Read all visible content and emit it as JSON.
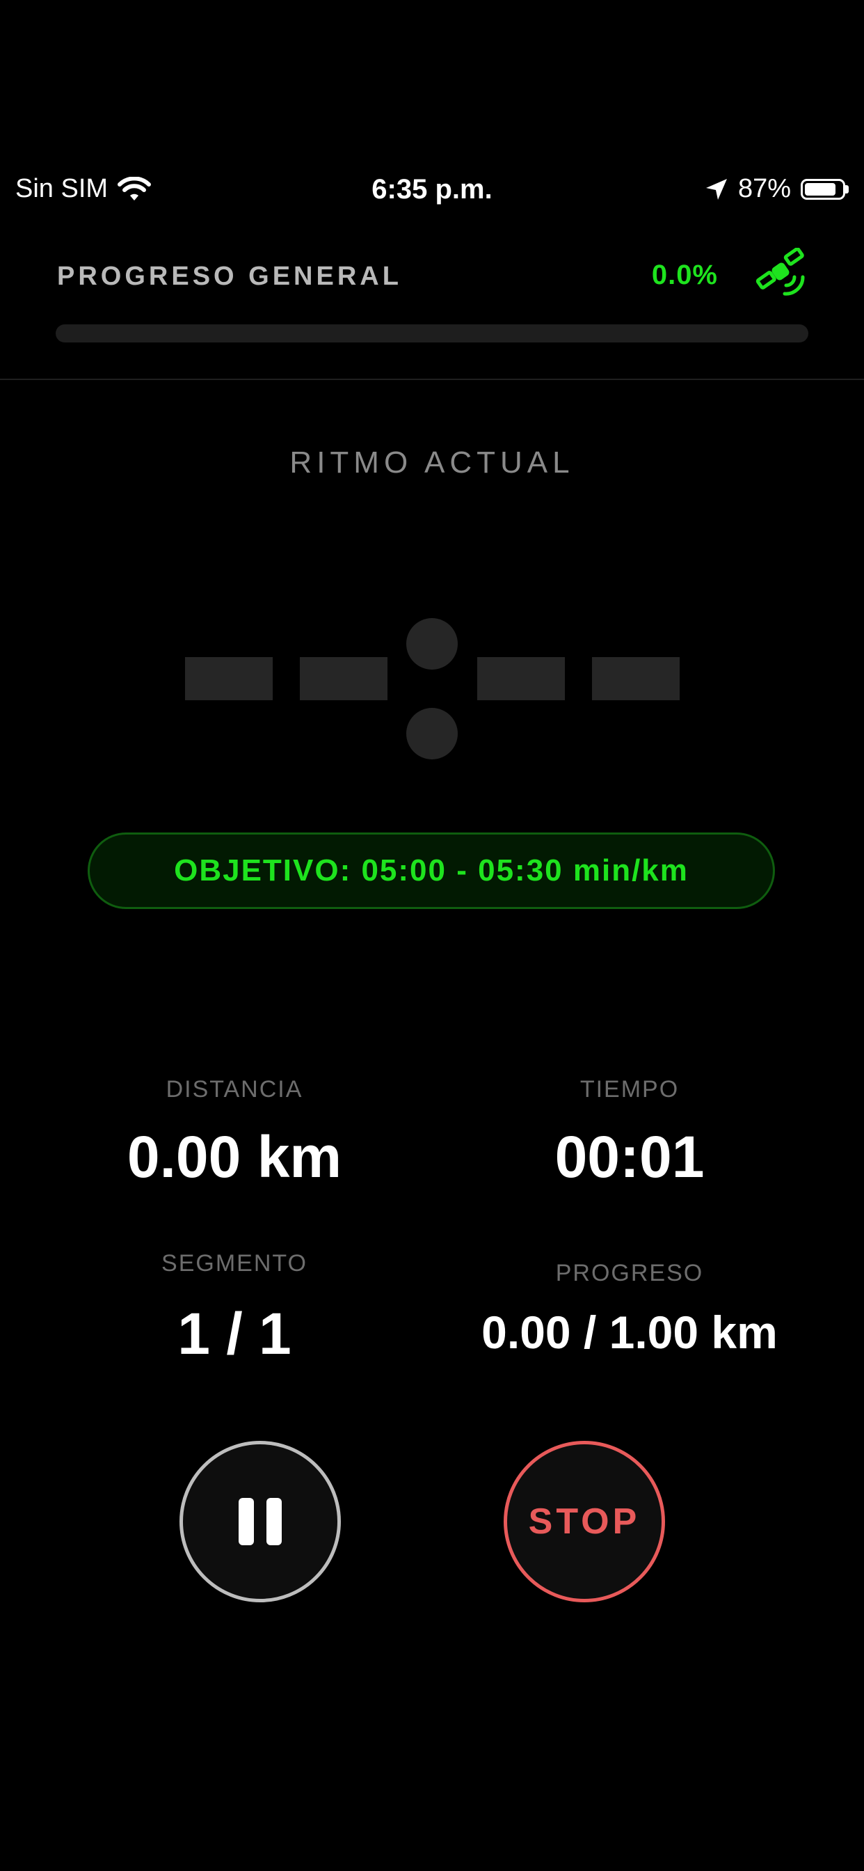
{
  "status_bar": {
    "carrier": "Sin SIM",
    "time": "6:35 p.m.",
    "battery": "87%",
    "battery_level": 0.87,
    "wifi_icon": "wifi-icon",
    "location_icon": "location-arrow-icon"
  },
  "header": {
    "title": "PROGRESO GENERAL",
    "progress_text": "0.0%",
    "progress_value": 0.0,
    "gps_icon": "satellite-icon"
  },
  "pace": {
    "label": "RITMO ACTUAL",
    "display": "--:--"
  },
  "target": {
    "text": "OBJETIVO: 05:00 - 05:30 min/km"
  },
  "stats": {
    "distance": {
      "label": "DISTANCIA",
      "value": "0.00 km"
    },
    "time": {
      "label": "TIEMPO",
      "value": "00:01"
    },
    "segment": {
      "label": "SEGMENTO",
      "value": "1 / 1"
    },
    "progress": {
      "label": "PROGRESO",
      "value": "0.00 / 1.00 km"
    }
  },
  "controls": {
    "pause_icon": "pause-icon",
    "stop_label": "STOP"
  },
  "colors": {
    "accent": "#1ee31e",
    "stop": "#e85a5a",
    "background": "#000000"
  }
}
